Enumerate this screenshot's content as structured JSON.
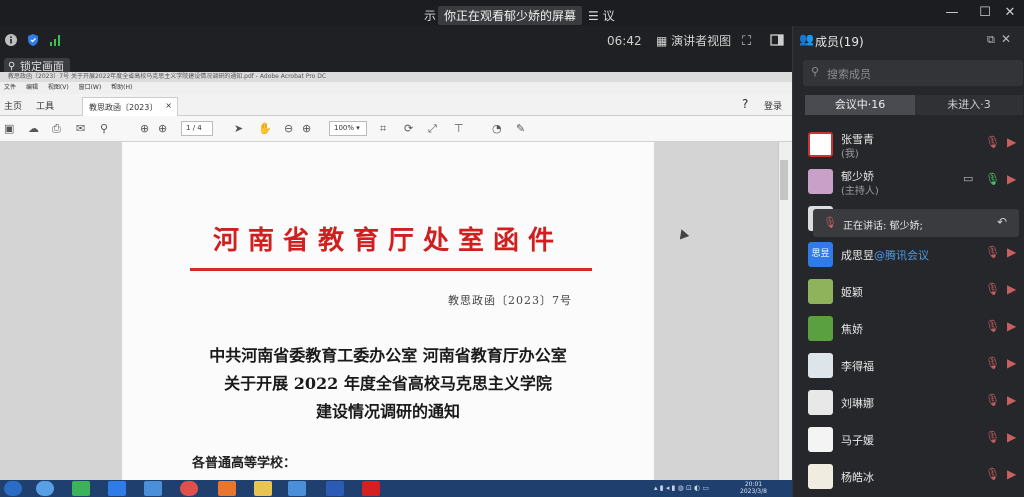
{
  "window": {
    "title_left": "示",
    "sharing_notice": "你正在观看郁少娇的屏幕",
    "notice_icon": "list-icon",
    "title_right": "议",
    "minimize": "—",
    "maximize": "☐",
    "close": "✕"
  },
  "meeting_bar": {
    "time": "06:42",
    "presenter_view": "演讲者视图",
    "lock_label": "锁定画面"
  },
  "acrobat": {
    "title": "教思政函〔2023〕7号 关于开展2022年度全省高校马克思主义学院建设情况调研的通知.pdf - Adobe Acrobat Pro DC",
    "menu": [
      "文件",
      "编辑",
      "视图(V)",
      "窗口(W)",
      "帮助(H)"
    ],
    "tab_home": "主页",
    "tab_tools": "工具",
    "tab_doc": "教思政函〔2023〕",
    "tab_close": "×",
    "sign_in": "登录",
    "page_field": "1",
    "page_total": "/ 4",
    "zoom": "100%"
  },
  "document": {
    "header": "河南省教育厅处室函件",
    "doc_number": "教思政函〔2023〕7号",
    "title_lines": [
      "中共河南省委教育工委办公室   河南省教育厅办公室",
      "关于开展 2022 年度全省高校马克思主义学院",
      "建设情况调研的通知"
    ],
    "salutation": "各普通高等学校："
  },
  "taskbar": {
    "clock_time": "20:01",
    "clock_date": "2023/3/8"
  },
  "members_panel": {
    "title": "成员(19)",
    "search_placeholder": "搜索成员",
    "tab_in_meeting": "会议中·16",
    "tab_not_joined": "未进入·3",
    "speaking": "正在讲话: 郁少娇;",
    "members": [
      {
        "name": "张雪青",
        "sub": "(我)"
      },
      {
        "name": "郁少娇",
        "sub": "(主持人)"
      },
      {
        "name": "成思昱",
        "tag": "@腾讯会议",
        "avatar_text": "思昱"
      },
      {
        "name": "姬颖",
        "sub": ""
      },
      {
        "name": "焦娇",
        "sub": ""
      },
      {
        "name": "李得福",
        "sub": ""
      },
      {
        "name": "刘琳娜",
        "sub": ""
      },
      {
        "name": "马子媛",
        "sub": ""
      },
      {
        "name": "杨皓冰",
        "sub": ""
      }
    ]
  },
  "colors": {
    "doc_header_red": "#d11e1e",
    "mic_muted": "#c86060",
    "mic_active": "#4cc46a",
    "link_blue": "#4a9be8"
  }
}
